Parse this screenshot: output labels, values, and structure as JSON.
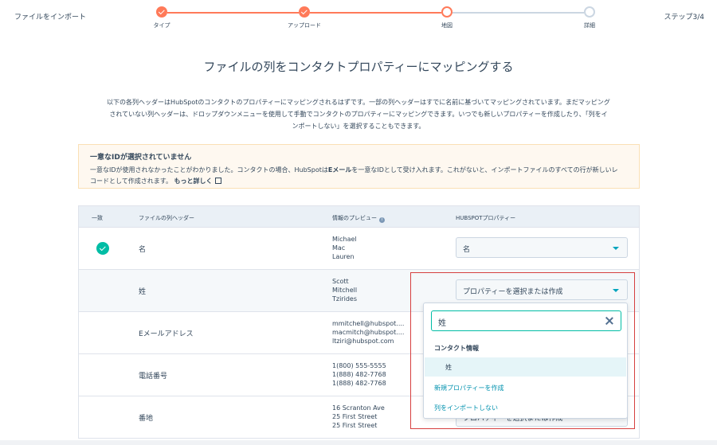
{
  "header": {
    "title": "ファイルをインポート",
    "step_indicator": "ステップ3/4",
    "steps": [
      {
        "label": "タイプ",
        "state": "done"
      },
      {
        "label": "アップロード",
        "state": "done"
      },
      {
        "label": "地図",
        "state": "current"
      },
      {
        "label": "詳細",
        "state": "todo"
      }
    ]
  },
  "page": {
    "heading": "ファイルの列をコンタクトプロパティーにマッピングする",
    "intro_line1": "以下の各列ヘッダーはHubSpotのコンタクトのプロパティーにマッピングされるはずです。一部の列ヘッダーはすでに名前に基づいてマッピングされています。まだマッピング",
    "intro_line2": "されていない列ヘッダーは、ドロップダウンメニューを使用して手動でコンタクトのプロパティーにマッピングできます。いつでも新しいプロパティーを作成したり、「列をイ",
    "intro_line3": "ンポートしない」を選択することもできます。"
  },
  "alert": {
    "title": "一意なIDが選択されていません",
    "body_part1": "一意なIDが使用されなかったことがわかりました。コンタクトの場合、HubSpotは",
    "body_bold": "Eメール",
    "body_part2": "を一意なIDとして受け入れます。これがないと、インポートファイルのすべての行が新しいレコードとして作成されます。",
    "link": "もっと詳しく"
  },
  "table": {
    "headers": {
      "match": "一致",
      "column": "ファイルの列ヘッダー",
      "preview": "情報のプレビュー",
      "property": "HUBSPOTプロパティー"
    },
    "rows": [
      {
        "matched": true,
        "column": "名",
        "preview": [
          "Michael",
          "Mac",
          "Lauren"
        ],
        "property": "名"
      },
      {
        "matched": false,
        "column": "姓",
        "preview": [
          "Scott",
          "Mitchell",
          "Tzirides"
        ],
        "property": "プロパティーを選択または作成"
      },
      {
        "matched": false,
        "column": "Eメールアドレス",
        "preview": [
          "mmitchell@hubspot....",
          "macmitch@hubspot....",
          "ltziri@hubspot.com"
        ],
        "property": ""
      },
      {
        "matched": false,
        "column": "電話番号",
        "preview": [
          "1(800) 555-5555",
          "1(888) 482-7768",
          "1(888) 482-7768"
        ],
        "property": ""
      },
      {
        "matched": false,
        "column": "番地",
        "preview": [
          "16 Scranton Ave",
          "25 First Street",
          "25 First Street"
        ],
        "property": "プロパティーを選択または作成"
      }
    ]
  },
  "dropdown": {
    "search_value": "姓",
    "group_header": "コンタクト情報",
    "option": "姓",
    "create_link": "新規プロパティーを作成",
    "skip_link": "列をインポートしない"
  },
  "colors": {
    "accent": "#ff7a59",
    "teal": "#00bda5",
    "link": "#0091ae",
    "highlight_border": "#d63f3f"
  }
}
